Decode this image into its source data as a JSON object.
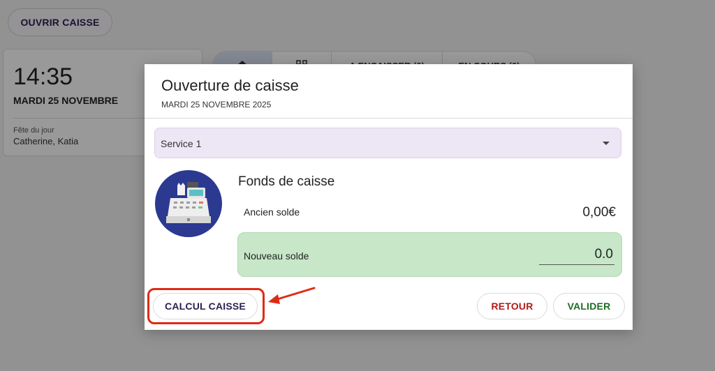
{
  "background": {
    "open_button": "OUVRIR CAISSE",
    "clock": {
      "time": "14:35",
      "date": "MARDI 25 NOVEMBRE",
      "fete_label": "Fête du jour",
      "fete_names": "Catherine, Katia"
    },
    "tabs": [
      {
        "label": ""
      },
      {
        "label": ""
      },
      {
        "label": "A ENCAISSER (0)"
      },
      {
        "label": "EN COURS (0)"
      }
    ]
  },
  "dialog": {
    "title": "Ouverture de caisse",
    "subtitle": "MARDI 25 NOVEMBRE 2025",
    "service": {
      "selected": "Service 1"
    },
    "fonds": {
      "title": "Fonds de caisse",
      "ancien_label": "Ancien solde",
      "ancien_value": "0,00€",
      "nouveau_label": "Nouveau solde",
      "nouveau_value": "0.0"
    },
    "buttons": {
      "calcul": "CALCUL CAISSE",
      "retour": "RETOUR",
      "valider": "VALIDER"
    }
  },
  "colors": {
    "overlay": "#666666",
    "service_bg": "#ece6f5",
    "nouveau_bg": "#c7e7c8",
    "icon_circle": "#2b3990",
    "retour_text": "#b01b1b",
    "valider_text": "#1f6b23",
    "annotation": "#e02a14"
  },
  "icons": [
    "home-icon",
    "grid-icon",
    "chevron-down-icon",
    "cash-register-icon",
    "annotation-arrow-icon"
  ]
}
